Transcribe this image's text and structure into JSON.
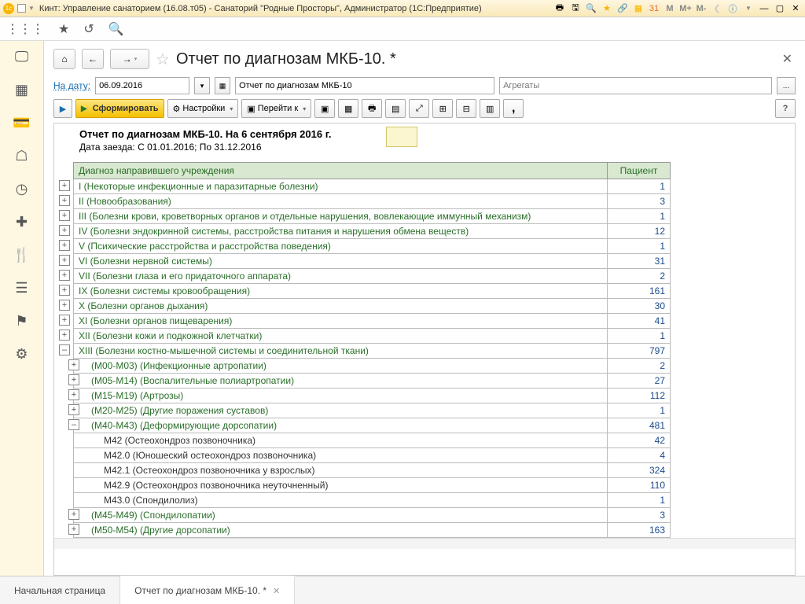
{
  "titlebar": {
    "title": "Кинт: Управление санаторием (16.08.т05) - Санаторий \"Родные Просторы\", Администратор  (1С:Предприятие)",
    "m1": "M",
    "m2": "M+",
    "m3": "M-"
  },
  "page": {
    "title": "Отчет по диагнозам МКБ-10. *"
  },
  "filter": {
    "datelabel": "На дату:",
    "date": "06.09.2016",
    "reportname": "Отчет по диагнозам МКБ-10",
    "aggr_ph": "Агрегаты"
  },
  "cmd": {
    "form": "Сформировать",
    "settings": "Настройки",
    "goto": "Перейти к"
  },
  "report": {
    "title": "Отчет по диагнозам МКБ-10. На 6 сентября 2016 г.",
    "dates": "Дата заезда: С 01.01.2016; По 31.12.2016",
    "col_diag": "Диагноз направившего учреждения",
    "col_pac": "Пациент",
    "rows": [
      {
        "lvl": 1,
        "exp": "+",
        "diag": "I (Некоторые инфекционные и паразитарные болезни)",
        "n": "1"
      },
      {
        "lvl": 1,
        "exp": "+",
        "diag": "II (Новообразования)",
        "n": "3"
      },
      {
        "lvl": 1,
        "exp": "+",
        "diag": "III (Болезни крови, кроветворных органов и отдельные нарушения, вовлекающие иммунный механизм)",
        "n": "1"
      },
      {
        "lvl": 1,
        "exp": "+",
        "diag": "IV (Болезни эндокринной системы, расстройства питания и нарушения обмена веществ)",
        "n": "12"
      },
      {
        "lvl": 1,
        "exp": "+",
        "diag": "V (Психические расстройства и расстройства поведения)",
        "n": "1"
      },
      {
        "lvl": 1,
        "exp": "+",
        "diag": "VI (Болезни нервной системы)",
        "n": "31"
      },
      {
        "lvl": 1,
        "exp": "+",
        "diag": "VII (Болезни глаза и его придаточного аппарата)",
        "n": "2"
      },
      {
        "lvl": 1,
        "exp": "+",
        "diag": "IX (Болезни системы кровообращения)",
        "n": "161"
      },
      {
        "lvl": 1,
        "exp": "+",
        "diag": "X (Болезни органов дыхания)",
        "n": "30"
      },
      {
        "lvl": 1,
        "exp": "+",
        "diag": "XI (Болезни органов пищеварения)",
        "n": "41"
      },
      {
        "lvl": 1,
        "exp": "+",
        "diag": "XII (Болезни кожи и подкожной клетчатки)",
        "n": "1"
      },
      {
        "lvl": 1,
        "exp": "–",
        "diag": "XIII (Болезни костно-мышечной системы и соединительной ткани)",
        "n": "797"
      },
      {
        "lvl": 2,
        "exp": "+",
        "diag": "(M00-M03) (Инфекционные артропатии)",
        "n": "2"
      },
      {
        "lvl": 2,
        "exp": "+",
        "diag": "(M05-M14) (Воспалительные полиартропатии)",
        "n": "27"
      },
      {
        "lvl": 2,
        "exp": "+",
        "diag": "(M15-M19) (Артрозы)",
        "n": "112"
      },
      {
        "lvl": 2,
        "exp": "+",
        "diag": "(M20-M25) (Другие поражения суставов)",
        "n": "1"
      },
      {
        "lvl": 2,
        "exp": "–",
        "diag": "(M40-M43) (Деформирующие дорсопатии)",
        "n": "481"
      },
      {
        "lvl": 3,
        "exp": "",
        "diag": "M42 (Остеохондроз позвоночника)",
        "n": "42"
      },
      {
        "lvl": 3,
        "exp": "",
        "diag": "M42.0 (Юношеский остеохондроз позвоночника)",
        "n": "4"
      },
      {
        "lvl": 3,
        "exp": "",
        "diag": "M42.1 (Остеохондроз позвоночника у взрослых)",
        "n": "324"
      },
      {
        "lvl": 3,
        "exp": "",
        "diag": "M42.9 (Остеохондроз позвоночника неуточненный)",
        "n": "110"
      },
      {
        "lvl": 3,
        "exp": "",
        "diag": "M43.0 (Спондилолиз)",
        "n": "1"
      },
      {
        "lvl": 2,
        "exp": "+",
        "diag": "(M45-M49) (Спондилопатии)",
        "n": "3"
      },
      {
        "lvl": 2,
        "exp": "+",
        "diag": "(M50-M54) (Другие дорсопатии)",
        "n": "163"
      }
    ]
  },
  "tabs": {
    "home": "Начальная страница",
    "report": "Отчет по диагнозам МКБ-10. *"
  }
}
